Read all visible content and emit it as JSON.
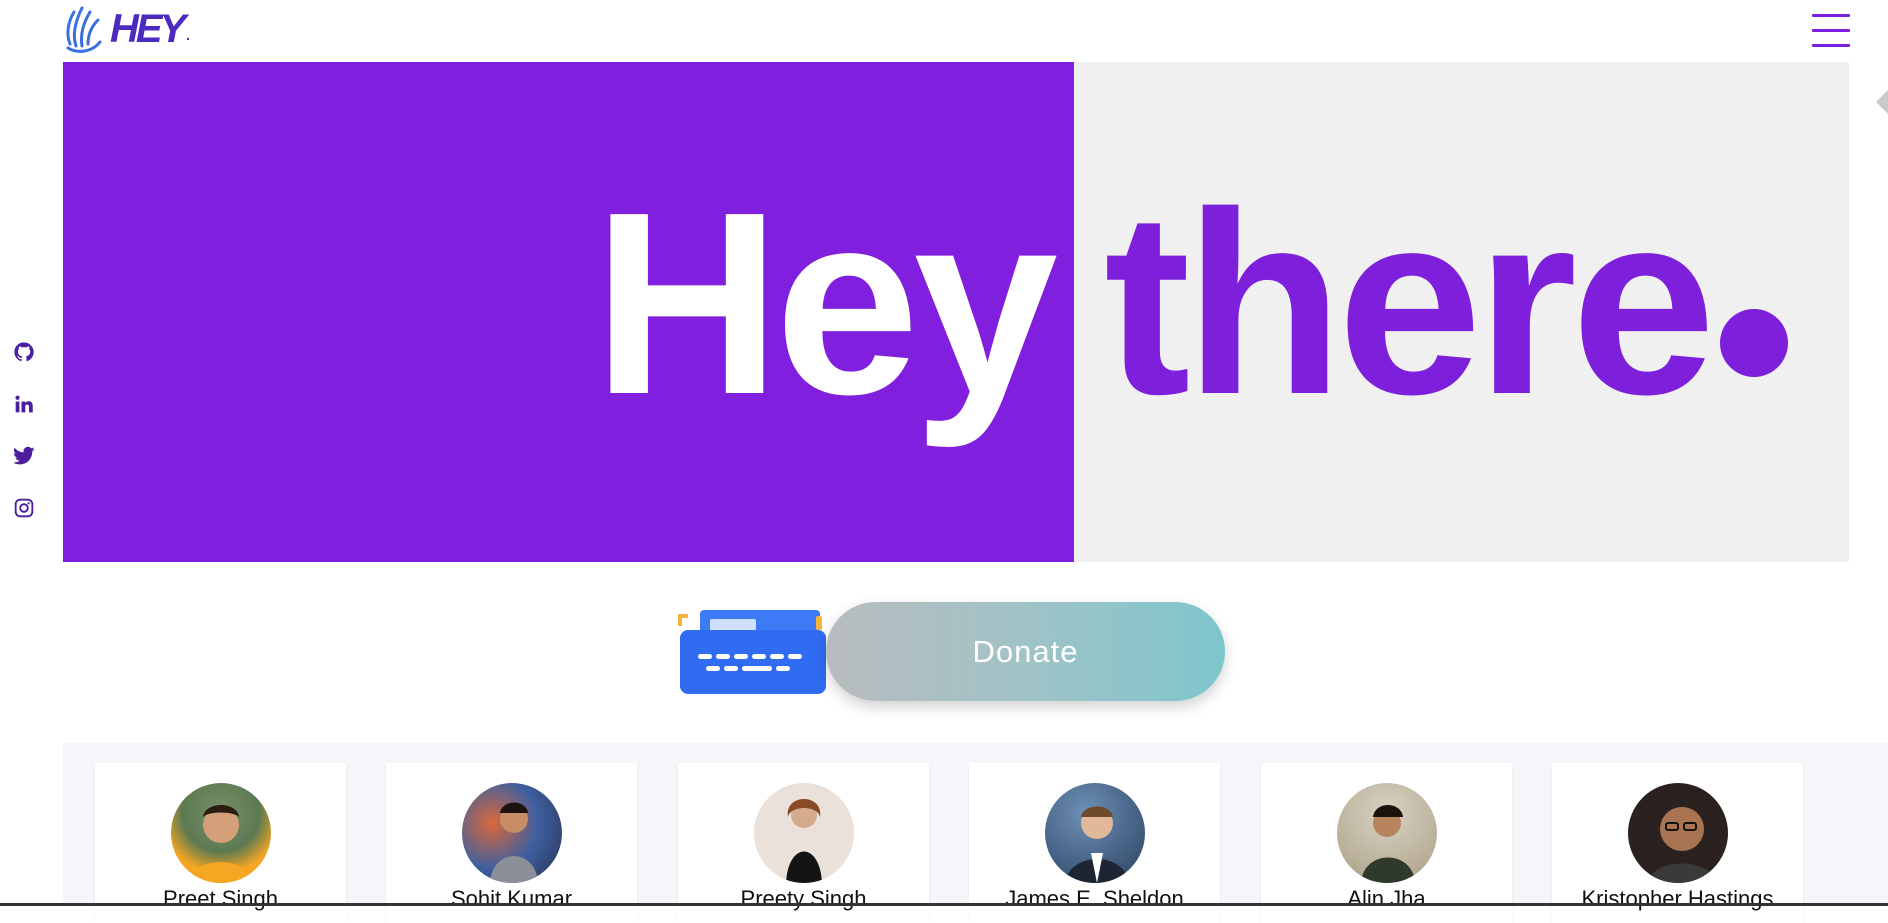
{
  "header": {
    "logo_text": "HEY",
    "logo_dot": ".",
    "menu_icon": "hamburger-menu-icon"
  },
  "hero": {
    "word_left": "Hey",
    "word_right": "there",
    "accent_color": "#801fdd",
    "right_bg": "#f0f0f0"
  },
  "socials": [
    {
      "icon": "github-icon"
    },
    {
      "icon": "linkedin-icon"
    },
    {
      "icon": "twitter-icon"
    },
    {
      "icon": "instagram-icon"
    }
  ],
  "donate": {
    "label": "Donate",
    "illustration": "typewriter-icon"
  },
  "team": [
    {
      "name": "Preet Singh"
    },
    {
      "name": "Sohit Kumar"
    },
    {
      "name": "Preety Singh"
    },
    {
      "name": "James E. Sheldon"
    },
    {
      "name": "Alin Jha"
    },
    {
      "name": "Kristopher Hastings"
    }
  ]
}
